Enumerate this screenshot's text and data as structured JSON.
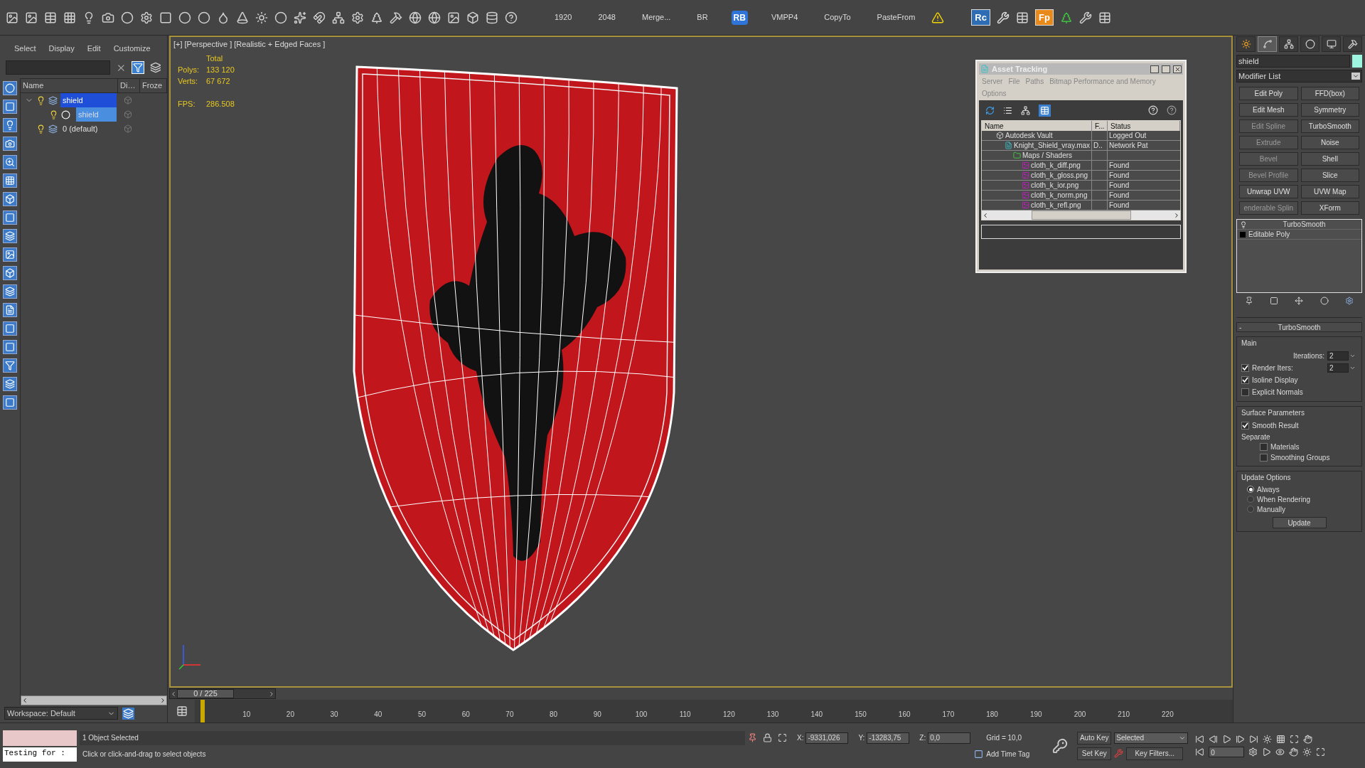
{
  "toolbar": {
    "items": [
      {
        "kind": "label",
        "text": "1920"
      },
      {
        "kind": "label",
        "text": "2048"
      },
      {
        "kind": "label",
        "text": "Merge..."
      },
      {
        "kind": "label",
        "text": "BR"
      },
      {
        "kind": "badge",
        "text": "RB",
        "color": "#2f74d8"
      },
      {
        "kind": "label",
        "text": "VMPP4"
      },
      {
        "kind": "label",
        "text": "CopyTo"
      },
      {
        "kind": "label",
        "text": "PasteFrom"
      }
    ],
    "plugins": [
      {
        "text": "Rc",
        "color": "#2e6db4"
      },
      {
        "text": "Fp",
        "color": "#e8891a"
      }
    ]
  },
  "scene_explorer": {
    "menu": [
      "Select",
      "Display",
      "Edit",
      "Customize"
    ],
    "columns": [
      "Name",
      "Di…",
      "Froze"
    ],
    "tree": [
      {
        "label": "shield",
        "kind": "layer",
        "selected": true,
        "children": [
          {
            "label": "shield",
            "kind": "object",
            "selected": true
          }
        ]
      },
      {
        "label": "0 (default)",
        "kind": "layer",
        "selected": false
      }
    ],
    "workspace": "Workspace: Default"
  },
  "viewport": {
    "labels": [
      "[+]",
      "[Perspective ]",
      "[Realistic + Edged Faces ]"
    ],
    "stats_header": "Total",
    "stats": [
      {
        "label": "Polys:",
        "value": "133 120"
      },
      {
        "label": "Verts:",
        "value": "67 672"
      },
      {
        "label": "FPS:",
        "value": "286.508"
      }
    ]
  },
  "asset_tracking": {
    "title": "Asset Tracking",
    "menu": [
      "Server",
      "File",
      "Paths",
      "Bitmap Performance and Memory",
      "Options"
    ],
    "columns": [
      "Name",
      "F...",
      "Status"
    ],
    "rows": [
      {
        "kind": "vault",
        "name": "Autodesk Vault",
        "status": "Logged Out",
        "children": [
          {
            "kind": "max",
            "name": "Knight_Shield_vray.max",
            "f": "D..",
            "status": "Network Pat",
            "children": [
              {
                "kind": "folder",
                "name": "Maps / Shaders",
                "children": [
                  {
                    "kind": "png",
                    "name": "cloth_k_diff.png",
                    "status": "Found"
                  },
                  {
                    "kind": "png",
                    "name": "cloth_k_gloss.png",
                    "status": "Found"
                  },
                  {
                    "kind": "png",
                    "name": "cloth_k_ior.png",
                    "status": "Found"
                  },
                  {
                    "kind": "png",
                    "name": "cloth_k_norm.png",
                    "status": "Found"
                  },
                  {
                    "kind": "png",
                    "name": "cloth_k_refl.png",
                    "status": "Found"
                  }
                ]
              }
            ]
          }
        ]
      }
    ]
  },
  "command_panel": {
    "object_name": "shield",
    "modifier_list": "Modifier List",
    "buttons": [
      {
        "label": "Edit Poly",
        "disabled": false
      },
      {
        "label": "FFD(box)",
        "disabled": false
      },
      {
        "label": "Edit Mesh",
        "disabled": false
      },
      {
        "label": "Symmetry",
        "disabled": false
      },
      {
        "label": "Edit Spline",
        "disabled": true
      },
      {
        "label": "TurboSmooth",
        "disabled": false
      },
      {
        "label": "Extrude",
        "disabled": true
      },
      {
        "label": "Noise",
        "disabled": false
      },
      {
        "label": "Bevel",
        "disabled": true
      },
      {
        "label": "Shell",
        "disabled": false
      },
      {
        "label": "Bevel Profile",
        "disabled": true
      },
      {
        "label": "Slice",
        "disabled": false
      },
      {
        "label": "Unwrap UVW",
        "disabled": false
      },
      {
        "label": "UVW Map",
        "disabled": false
      },
      {
        "label": "enderable Splin",
        "disabled": true
      },
      {
        "label": "XForm",
        "disabled": false
      }
    ],
    "stack": [
      {
        "kind": "modifier",
        "label": "TurboSmooth"
      },
      {
        "kind": "base",
        "label": "Editable Poly"
      }
    ],
    "tabs": [
      {
        "selected": false
      },
      {
        "selected": true
      },
      {
        "selected": false
      },
      {
        "selected": false
      },
      {
        "selected": false
      },
      {
        "selected": false
      }
    ],
    "rollout": {
      "sign": "-",
      "title": "TurboSmooth",
      "groups": [
        {
          "title": "Main",
          "controls": [
            {
              "kind": "spinner",
              "label": "Iterations:",
              "value": "2"
            },
            {
              "kind": "check_spinner",
              "label": "Render Iters:",
              "value": "2",
              "checked": true
            },
            {
              "kind": "checkbox",
              "label": "Isoline Display",
              "checked": true
            },
            {
              "kind": "checkbox",
              "label": "Explicit Normals",
              "checked": false
            }
          ]
        },
        {
          "title": "Surface Parameters",
          "controls": [
            {
              "kind": "checkbox",
              "label": "Smooth Result",
              "checked": true
            },
            {
              "kind": "label",
              "label": "Separate"
            },
            {
              "kind": "sub_checkbox",
              "label": "Materials",
              "checked": false
            },
            {
              "kind": "sub_checkbox",
              "label": "Smoothing Groups",
              "checked": false
            }
          ]
        },
        {
          "title": "Update Options",
          "controls": [
            {
              "kind": "radio",
              "label": "Always",
              "selected": true
            },
            {
              "kind": "radio",
              "label": "When Rendering",
              "selected": false
            },
            {
              "kind": "radio",
              "label": "Manually",
              "selected": false
            },
            {
              "kind": "button",
              "label": "Update"
            }
          ]
        }
      ]
    }
  },
  "timeline": {
    "slider": {
      "text": "0 / 225"
    },
    "ticks": [
      "10",
      "20",
      "30",
      "40",
      "50",
      "60",
      "70",
      "80",
      "90",
      "100",
      "110",
      "120",
      "130",
      "140",
      "150",
      "160",
      "170",
      "180",
      "190",
      "200",
      "210",
      "220"
    ]
  },
  "status_bar": {
    "listener": "Testing for :",
    "selection": "1 Object Selected",
    "prompt": "Click or click-and-drag to select objects",
    "coords": [
      {
        "label": "X:",
        "value": "-9331,026"
      },
      {
        "label": "Y:",
        "value": "-13283,75"
      },
      {
        "label": "Z:",
        "value": "0,0"
      }
    ],
    "grid": "Grid = 10,0",
    "time_tag": "Add Time Tag",
    "auto_key": "Auto Key",
    "set_key": "Set Key",
    "key_mode": "Selected",
    "key_filters": "Key Filters...",
    "frame": "0"
  }
}
